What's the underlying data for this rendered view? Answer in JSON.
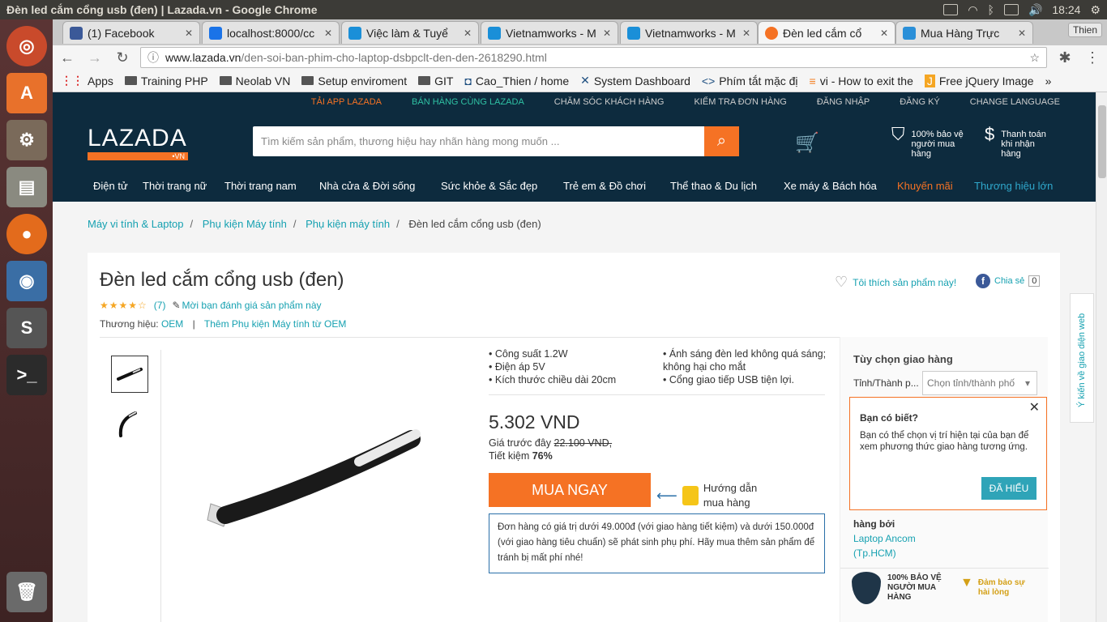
{
  "window": {
    "title": "Đèn led cắm cổng usb (đen) | Lazada.vn - Google Chrome",
    "clock": "18:24"
  },
  "tabs": [
    {
      "label": "(1) Facebook",
      "color": "#3b5998"
    },
    {
      "label": "localhost:8000/cc",
      "color": "#1a73e8"
    },
    {
      "label": "Việc làm & Tuyể",
      "color": "#1a8fd8"
    },
    {
      "label": "Vietnamworks - M",
      "color": "#1a8fd8"
    },
    {
      "label": "Vietnamworks - M",
      "color": "#1a8fd8"
    },
    {
      "label": "Đèn led cắm cổ",
      "color": "#f57224"
    },
    {
      "label": "Mua Hàng Trực",
      "color": "#2a8fd8"
    }
  ],
  "profile": "Thien",
  "address": {
    "host": "www.lazada.vn",
    "path": "/den-soi-ban-phim-cho-laptop-dsbpclt-den-den-2618290.html"
  },
  "bookmarks": [
    "Apps",
    "Training PHP",
    "Neolab VN",
    "Setup enviroment",
    "GIT",
    "Cao_Thien / home",
    "System Dashboard",
    "Phím tắt mặc đị",
    "vi - How to exit the",
    "Free jQuery Image"
  ],
  "header_links": [
    "TẢI APP LAZADA",
    "BÁN HÀNG CÙNG LAZADA",
    "CHĂM SÓC KHÁCH HÀNG",
    "KIỂM TRA ĐƠN HÀNG",
    "ĐĂNG NHẬP",
    "ĐĂNG KÝ",
    "CHANGE LANGUAGE"
  ],
  "logo": {
    "name": "LAZADA",
    "suffix": "•VN"
  },
  "search": {
    "placeholder": "Tìm kiếm sản phẩm, thương hiệu hay nhãn hàng mong muốn ..."
  },
  "promises": [
    {
      "text": "100% bảo vệ người mua hàng"
    },
    {
      "text": "Thanh toán khi nhận hàng"
    }
  ],
  "nav": [
    "Điện tử",
    "Thời trang nữ",
    "Thời trang nam",
    "Nhà cửa & Đời sống",
    "Sức khỏe & Sắc đẹp",
    "Trẻ em & Đồ chơi",
    "Thể thao & Du lịch",
    "Xe máy & Bách hóa",
    "Khuyến mãi",
    "Thương hiệu lớn"
  ],
  "breadcrumb": [
    "Máy vi tính & Laptop",
    "Phụ kiện Máy tính",
    "Phụ kiện máy tính",
    "Đèn led cắm cổng usb (đen)"
  ],
  "product": {
    "title": "Đèn led cắm cổng usb (đen)",
    "rating_count": "(7)",
    "rating_value": 3.5,
    "review_prompt": "Mời bạn đánh giá sản phẩm này",
    "brand_label": "Thương hiệu:",
    "brand": "OEM",
    "brand_more": "Thêm Phụ kiện Máy tính từ OEM",
    "wish": "Tôi thích sản phẩm này!",
    "share": "Chia sẻ",
    "share_count": "0",
    "features": [
      "Công suất 1.2W",
      "Ánh sáng đèn led không quá sáng; không hại cho mắt",
      "Điện áp 5V",
      "Cổng giao tiếp USB tiện lợi.",
      "Kích thước chiều dài 20cm"
    ],
    "price": "5.302 VND",
    "old_price_label": "Giá trước đây",
    "old_price": "22.100 VND,",
    "save_label": "Tiết kiệm",
    "save_value": "76%",
    "buy": "MUA NGAY",
    "guide": [
      "Hướng dẫn",
      "mua hàng"
    ],
    "note": "Đơn hàng có giá trị dưới 49.000đ (với giao hàng tiết kiệm) và dưới 150.000đ (với giao hàng tiêu chuẩn) sẽ phát sinh phụ phí. Hãy mua thêm sản phẩm để tránh bị mất phí nhé!"
  },
  "delivery": {
    "title": "Tùy chọn giao hàng",
    "province_label": "Tỉnh/Thành p...",
    "province_placeholder": "Chọn tỉnh/thành phố",
    "seller_label": "hàng bởi",
    "seller_name": "Laptop Ancom",
    "seller_city": "(Tp.HCM)",
    "guarantee1": "100% BẢO VỆ NGƯỜI MUA HÀNG",
    "guarantee2": "Đảm bảo sự hài lòng"
  },
  "popup": {
    "title": "Bạn có biết?",
    "body": "Bạn có thể chọn vị trí hiện tại của bạn để xem phương thức giao hàng tương ứng.",
    "ok": "ĐÃ HIỂU"
  },
  "feedback": "Ý kiến về giao diện web"
}
